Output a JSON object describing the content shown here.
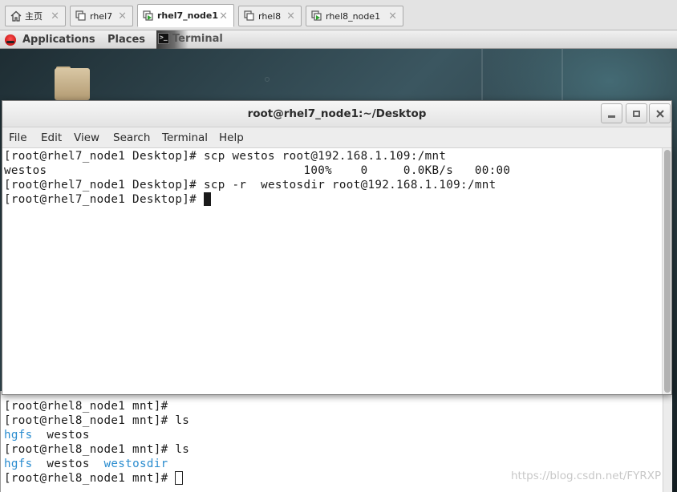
{
  "vm_tabs": [
    {
      "label": "主页",
      "icon": "home-icon",
      "active": false
    },
    {
      "label": "rhel7",
      "icon": "vm-icon",
      "active": false
    },
    {
      "label": "rhel7_node1",
      "icon": "vm-running-icon",
      "active": true
    },
    {
      "label": "rhel8",
      "icon": "vm-icon",
      "active": false
    },
    {
      "label": "rhel8_node1",
      "icon": "vm-running-icon",
      "active": false
    }
  ],
  "tab_close_glyph": "×",
  "panel": {
    "applications": "Applications",
    "places": "Places",
    "terminal": "Terminal"
  },
  "window": {
    "title": "root@rhel7_node1:~/Desktop",
    "menu": [
      "File",
      "Edit",
      "View",
      "Search",
      "Terminal",
      "Help"
    ],
    "lines": [
      "[root@rhel7_node1 Desktop]# scp westos root@192.168.1.109:/mnt",
      "westos                                    100%    0     0.0KB/s   00:00",
      "[root@rhel7_node1 Desktop]# scp -r  westosdir root@192.168.1.109:/mnt",
      "[root@rhel7_node1 Desktop]# "
    ]
  },
  "bg_terminal": {
    "lines": [
      {
        "text": "[root@rhel8_node1 mnt]#"
      },
      {
        "text": "[root@rhel8_node1 mnt]# ls"
      },
      {
        "parts": [
          "hgfs",
          "  westos"
        ]
      },
      {
        "text": "[root@rhel8_node1 mnt]# ls"
      },
      {
        "parts": [
          "hgfs",
          "  westos  ",
          "westosdir"
        ]
      },
      {
        "text": "[root@rhel8_node1 mnt]# "
      }
    ]
  },
  "watermark": "https://blog.csdn.net/FYRXP",
  "colors": {
    "ls_directory": "#2a8ccf",
    "desktop": "#2b3d43"
  }
}
